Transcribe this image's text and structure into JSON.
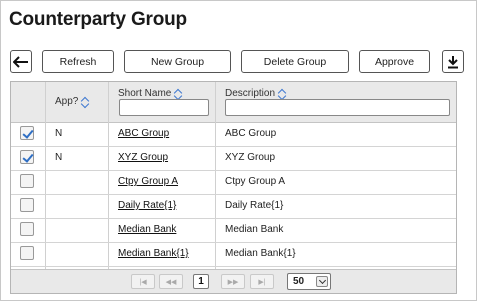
{
  "page": {
    "title": "Counterparty Group"
  },
  "toolbar": {
    "refresh_label": "Refresh",
    "new_group_label": "New Group",
    "delete_group_label": "Delete Group",
    "approve_label": "Approve"
  },
  "grid": {
    "columns": {
      "approved": "App?",
      "short_name": "Short Name",
      "description": "Description"
    },
    "rows": [
      {
        "checked": true,
        "approved": "N",
        "short_name": "ABC Group",
        "description": "ABC Group"
      },
      {
        "checked": true,
        "approved": "N",
        "short_name": "XYZ Group",
        "description": "XYZ Group"
      },
      {
        "checked": false,
        "approved": "",
        "short_name": "Ctpy Group A",
        "description": "Ctpy Group A"
      },
      {
        "checked": false,
        "approved": "",
        "short_name": "Daily Rate{1}",
        "description": "Daily Rate{1}"
      },
      {
        "checked": false,
        "approved": "",
        "short_name": "Median Bank",
        "description": "Median Bank"
      },
      {
        "checked": false,
        "approved": "",
        "short_name": "Median Bank{1}",
        "description": "Median Bank{1}"
      }
    ]
  },
  "pager": {
    "current_page": "1",
    "page_size": "50"
  }
}
